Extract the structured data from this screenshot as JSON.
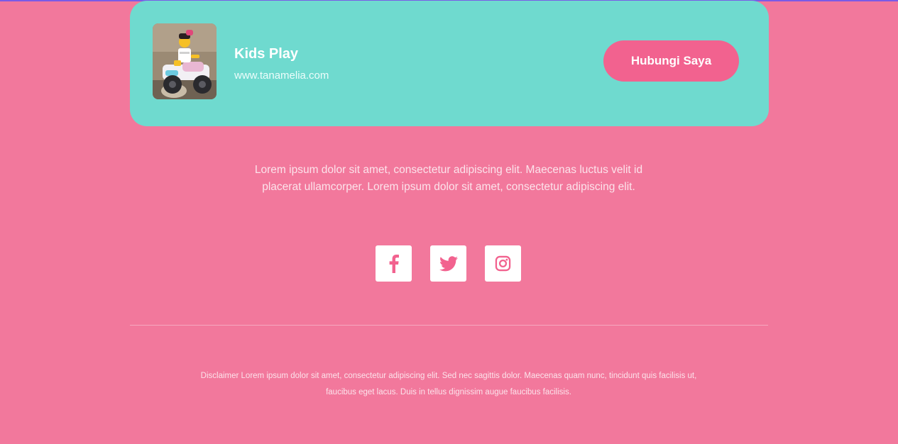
{
  "header": {
    "brand_title": "Kids Play",
    "brand_url": "www.tanamelia.com",
    "contact_button_label": "Hubungi Saya",
    "avatar_alt": "Toy figure on ATV"
  },
  "main": {
    "lead_text": "Lorem ipsum dolor sit amet, consectetur adipiscing elit. Maecenas luctus velit id placerat ullamcorper. Lorem ipsum dolor sit amet, consectetur adipiscing elit."
  },
  "social": {
    "items": [
      {
        "name": "facebook",
        "icon": "facebook-icon"
      },
      {
        "name": "twitter",
        "icon": "twitter-icon"
      },
      {
        "name": "instagram",
        "icon": "instagram-icon"
      }
    ]
  },
  "footer": {
    "disclaimer": "Disclaimer Lorem ipsum dolor sit amet, consectetur adipiscing elit. Sed nec sagittis dolor. Maecenas quam nunc, tincidunt quis facilisis ut, faucibus eget lacus. Duis in tellus dignissim augue faucibus facilisis."
  },
  "colors": {
    "background": "#F2789C",
    "card": "#6FDACF",
    "button": "#F2628F",
    "icon": "#F2628F"
  }
}
